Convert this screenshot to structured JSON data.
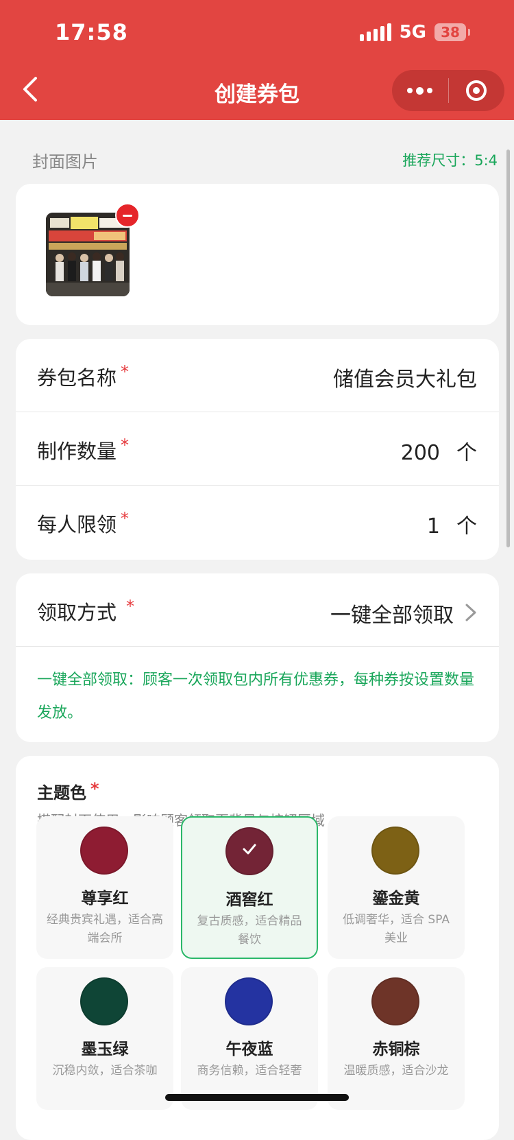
{
  "status_bar": {
    "time": "17:58",
    "network": "5G",
    "battery": "38"
  },
  "nav": {
    "title": "创建券包"
  },
  "cover": {
    "section_label": "封面图片",
    "hint": "推荐尺寸：5:4"
  },
  "form": {
    "rows": [
      {
        "label": "券包名称",
        "value": "储值会员大礼包",
        "unit": ""
      },
      {
        "label": "制作数量",
        "value": "200",
        "unit": "个"
      },
      {
        "label": "每人限领",
        "value": "1",
        "unit": "个"
      }
    ],
    "required_mark": "*"
  },
  "claim": {
    "label": "领取方式",
    "value": "一键全部领取",
    "description": "一键全部领取：顾客一次领取包内所有优惠券，每种券按设置数量发放。"
  },
  "theme": {
    "title": "主题色",
    "subtitle": "搭配封面使用，影响顾客领取页背景与按钮区域",
    "options": [
      {
        "name": "尊享红",
        "desc": "经典贵宾礼遇，适合高端会所",
        "color": "#8e1c32",
        "selected": false
      },
      {
        "name": "酒窖红",
        "desc": "复古质感，适合精品餐饮",
        "color": "#732436",
        "selected": true
      },
      {
        "name": "鎏金黄",
        "desc": "低调奢华，适合 SPA 美业",
        "color": "#7d6115",
        "selected": false
      },
      {
        "name": "墨玉绿",
        "desc": "沉稳内敛，适合茶咖",
        "color": "#0f4536",
        "selected": false
      },
      {
        "name": "午夜蓝",
        "desc": "商务信赖，适合轻奢",
        "color": "#2433a1",
        "selected": false
      },
      {
        "name": "赤铜棕",
        "desc": "温暖质感，适合沙龙",
        "color": "#6e3428",
        "selected": false
      }
    ]
  },
  "colors": {
    "header": "#e24541",
    "accent_green": "#19a65a",
    "required_red": "#e5383b"
  }
}
